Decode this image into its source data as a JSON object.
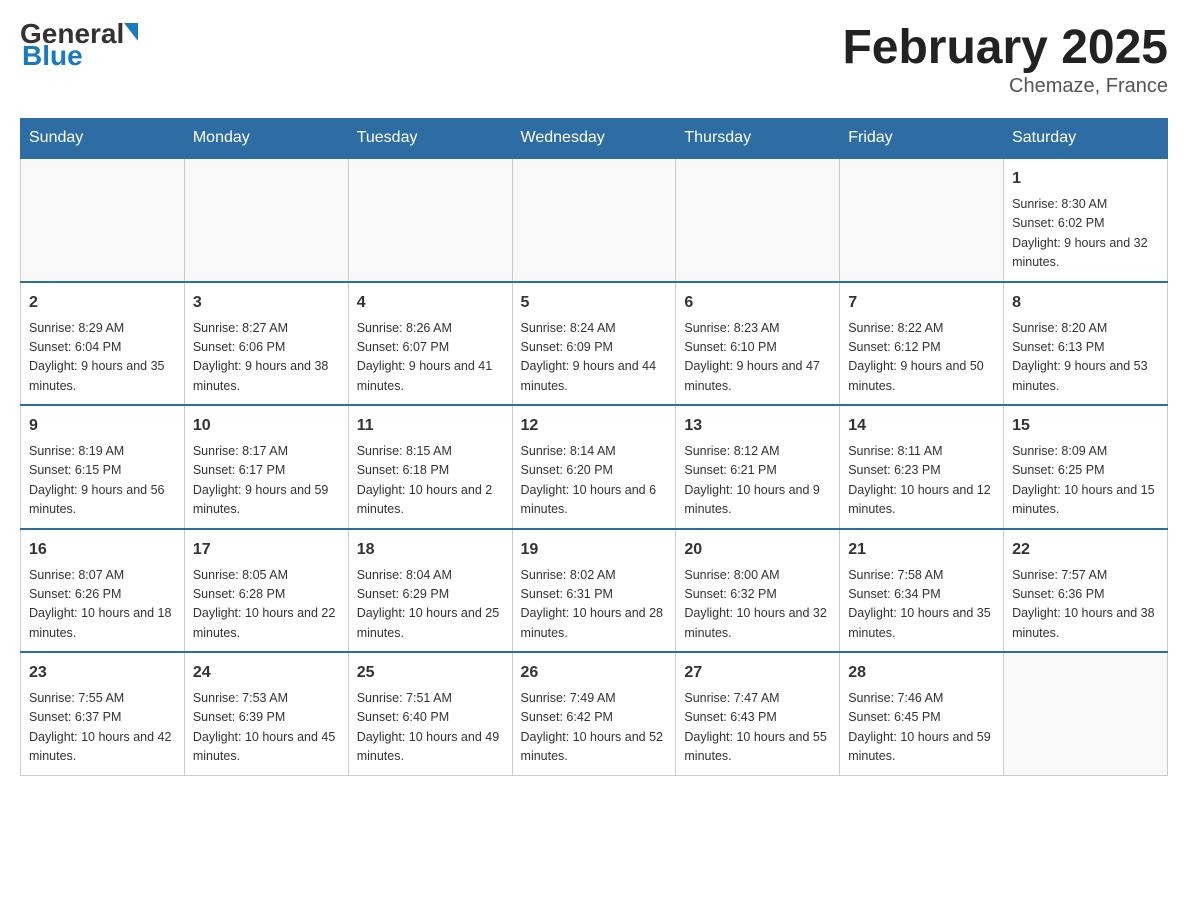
{
  "header": {
    "logo_general": "General",
    "logo_blue": "Blue",
    "month_title": "February 2025",
    "location": "Chemaze, France"
  },
  "weekdays": [
    "Sunday",
    "Monday",
    "Tuesday",
    "Wednesday",
    "Thursday",
    "Friday",
    "Saturday"
  ],
  "weeks": [
    [
      {
        "day": "",
        "info": ""
      },
      {
        "day": "",
        "info": ""
      },
      {
        "day": "",
        "info": ""
      },
      {
        "day": "",
        "info": ""
      },
      {
        "day": "",
        "info": ""
      },
      {
        "day": "",
        "info": ""
      },
      {
        "day": "1",
        "info": "Sunrise: 8:30 AM\nSunset: 6:02 PM\nDaylight: 9 hours and 32 minutes."
      }
    ],
    [
      {
        "day": "2",
        "info": "Sunrise: 8:29 AM\nSunset: 6:04 PM\nDaylight: 9 hours and 35 minutes."
      },
      {
        "day": "3",
        "info": "Sunrise: 8:27 AM\nSunset: 6:06 PM\nDaylight: 9 hours and 38 minutes."
      },
      {
        "day": "4",
        "info": "Sunrise: 8:26 AM\nSunset: 6:07 PM\nDaylight: 9 hours and 41 minutes."
      },
      {
        "day": "5",
        "info": "Sunrise: 8:24 AM\nSunset: 6:09 PM\nDaylight: 9 hours and 44 minutes."
      },
      {
        "day": "6",
        "info": "Sunrise: 8:23 AM\nSunset: 6:10 PM\nDaylight: 9 hours and 47 minutes."
      },
      {
        "day": "7",
        "info": "Sunrise: 8:22 AM\nSunset: 6:12 PM\nDaylight: 9 hours and 50 minutes."
      },
      {
        "day": "8",
        "info": "Sunrise: 8:20 AM\nSunset: 6:13 PM\nDaylight: 9 hours and 53 minutes."
      }
    ],
    [
      {
        "day": "9",
        "info": "Sunrise: 8:19 AM\nSunset: 6:15 PM\nDaylight: 9 hours and 56 minutes."
      },
      {
        "day": "10",
        "info": "Sunrise: 8:17 AM\nSunset: 6:17 PM\nDaylight: 9 hours and 59 minutes."
      },
      {
        "day": "11",
        "info": "Sunrise: 8:15 AM\nSunset: 6:18 PM\nDaylight: 10 hours and 2 minutes."
      },
      {
        "day": "12",
        "info": "Sunrise: 8:14 AM\nSunset: 6:20 PM\nDaylight: 10 hours and 6 minutes."
      },
      {
        "day": "13",
        "info": "Sunrise: 8:12 AM\nSunset: 6:21 PM\nDaylight: 10 hours and 9 minutes."
      },
      {
        "day": "14",
        "info": "Sunrise: 8:11 AM\nSunset: 6:23 PM\nDaylight: 10 hours and 12 minutes."
      },
      {
        "day": "15",
        "info": "Sunrise: 8:09 AM\nSunset: 6:25 PM\nDaylight: 10 hours and 15 minutes."
      }
    ],
    [
      {
        "day": "16",
        "info": "Sunrise: 8:07 AM\nSunset: 6:26 PM\nDaylight: 10 hours and 18 minutes."
      },
      {
        "day": "17",
        "info": "Sunrise: 8:05 AM\nSunset: 6:28 PM\nDaylight: 10 hours and 22 minutes."
      },
      {
        "day": "18",
        "info": "Sunrise: 8:04 AM\nSunset: 6:29 PM\nDaylight: 10 hours and 25 minutes."
      },
      {
        "day": "19",
        "info": "Sunrise: 8:02 AM\nSunset: 6:31 PM\nDaylight: 10 hours and 28 minutes."
      },
      {
        "day": "20",
        "info": "Sunrise: 8:00 AM\nSunset: 6:32 PM\nDaylight: 10 hours and 32 minutes."
      },
      {
        "day": "21",
        "info": "Sunrise: 7:58 AM\nSunset: 6:34 PM\nDaylight: 10 hours and 35 minutes."
      },
      {
        "day": "22",
        "info": "Sunrise: 7:57 AM\nSunset: 6:36 PM\nDaylight: 10 hours and 38 minutes."
      }
    ],
    [
      {
        "day": "23",
        "info": "Sunrise: 7:55 AM\nSunset: 6:37 PM\nDaylight: 10 hours and 42 minutes."
      },
      {
        "day": "24",
        "info": "Sunrise: 7:53 AM\nSunset: 6:39 PM\nDaylight: 10 hours and 45 minutes."
      },
      {
        "day": "25",
        "info": "Sunrise: 7:51 AM\nSunset: 6:40 PM\nDaylight: 10 hours and 49 minutes."
      },
      {
        "day": "26",
        "info": "Sunrise: 7:49 AM\nSunset: 6:42 PM\nDaylight: 10 hours and 52 minutes."
      },
      {
        "day": "27",
        "info": "Sunrise: 7:47 AM\nSunset: 6:43 PM\nDaylight: 10 hours and 55 minutes."
      },
      {
        "day": "28",
        "info": "Sunrise: 7:46 AM\nSunset: 6:45 PM\nDaylight: 10 hours and 59 minutes."
      },
      {
        "day": "",
        "info": ""
      }
    ]
  ]
}
